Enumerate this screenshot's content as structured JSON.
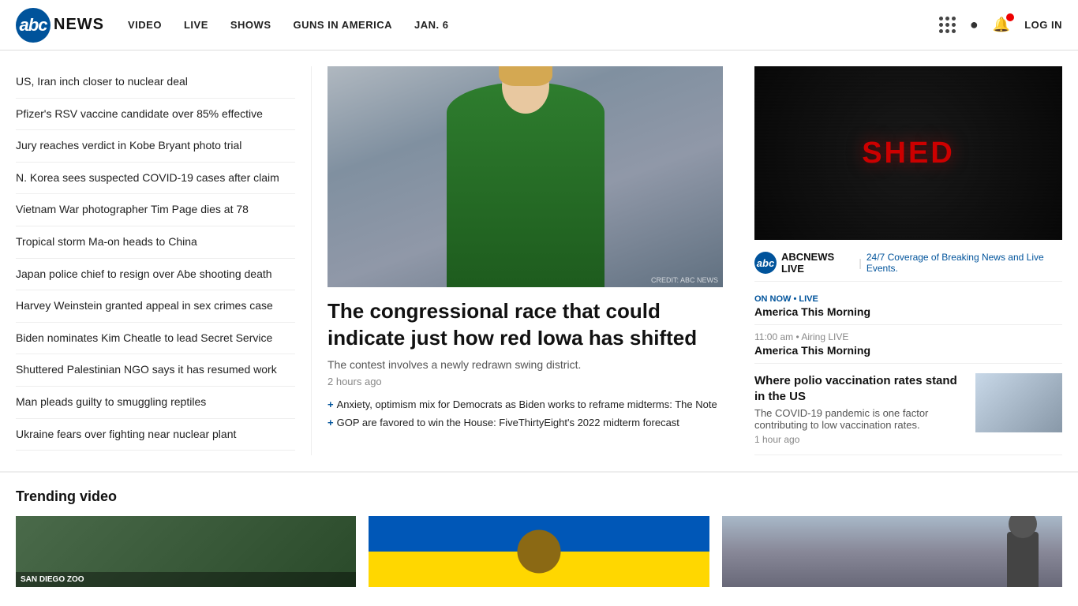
{
  "header": {
    "logo_text": "abc",
    "logo_news": "NEWS",
    "nav": [
      {
        "label": "VIDEO",
        "id": "nav-video"
      },
      {
        "label": "LIVE",
        "id": "nav-live"
      },
      {
        "label": "SHOWS",
        "id": "nav-shows"
      },
      {
        "label": "GUNS IN AMERICA",
        "id": "nav-guns"
      },
      {
        "label": "JAN. 6",
        "id": "nav-jan6"
      }
    ],
    "login_label": "LOG IN"
  },
  "sidebar": {
    "items": [
      {
        "text": "US, Iran inch closer to nuclear deal"
      },
      {
        "text": "Pfizer's RSV vaccine candidate over 85% effective"
      },
      {
        "text": "Jury reaches verdict in Kobe Bryant photo trial"
      },
      {
        "text": "N. Korea sees suspected COVID-19 cases after claim"
      },
      {
        "text": "Vietnam War photographer Tim Page dies at 78"
      },
      {
        "text": "Tropical storm Ma-on heads to China"
      },
      {
        "text": "Japan police chief to resign over Abe shooting death"
      },
      {
        "text": "Harvey Weinstein granted appeal in sex crimes case"
      },
      {
        "text": "Biden nominates Kim Cheatle to lead Secret Service"
      },
      {
        "text": "Shuttered Palestinian NGO says it has resumed work"
      },
      {
        "text": "Man pleads guilty to smuggling reptiles"
      },
      {
        "text": "Ukraine fears over fighting near nuclear plant"
      }
    ]
  },
  "main_article": {
    "title": "The congressional race that could indicate just how red Iowa has shifted",
    "description": "The contest involves a newly redrawn swing district.",
    "time": "2 hours ago",
    "img_caption": "CREDIT: ABC NEWS",
    "related": [
      {
        "text": "Anxiety, optimism mix for Democrats as Biden works to reframe midterms: The Note"
      },
      {
        "text": "GOP are favored to win the House: FiveThirtyEight's 2022 midterm forecast"
      }
    ]
  },
  "right_sidebar": {
    "live_video_text": "SHED",
    "abc_news_live_label": "ABCNEWS LIVE",
    "abc_live_desc": "24/7 Coverage of Breaking News and Live Events.",
    "on_now_badge": "ON NOW • LIVE",
    "on_now_show": "America This Morning",
    "schedule": [
      {
        "time": "11:00 am • Airing LIVE",
        "show": "America This Morning"
      }
    ],
    "polio": {
      "title": "Where polio vaccination rates stand in the US",
      "description": "The COVID-19 pandemic is one factor contributing to low vaccination rates.",
      "time": "1 hour ago"
    }
  },
  "trending": {
    "section_title": "Trending video",
    "videos": [
      {
        "label": "SAN DIEGO ZOO"
      },
      {
        "label": ""
      },
      {
        "label": ""
      }
    ]
  }
}
